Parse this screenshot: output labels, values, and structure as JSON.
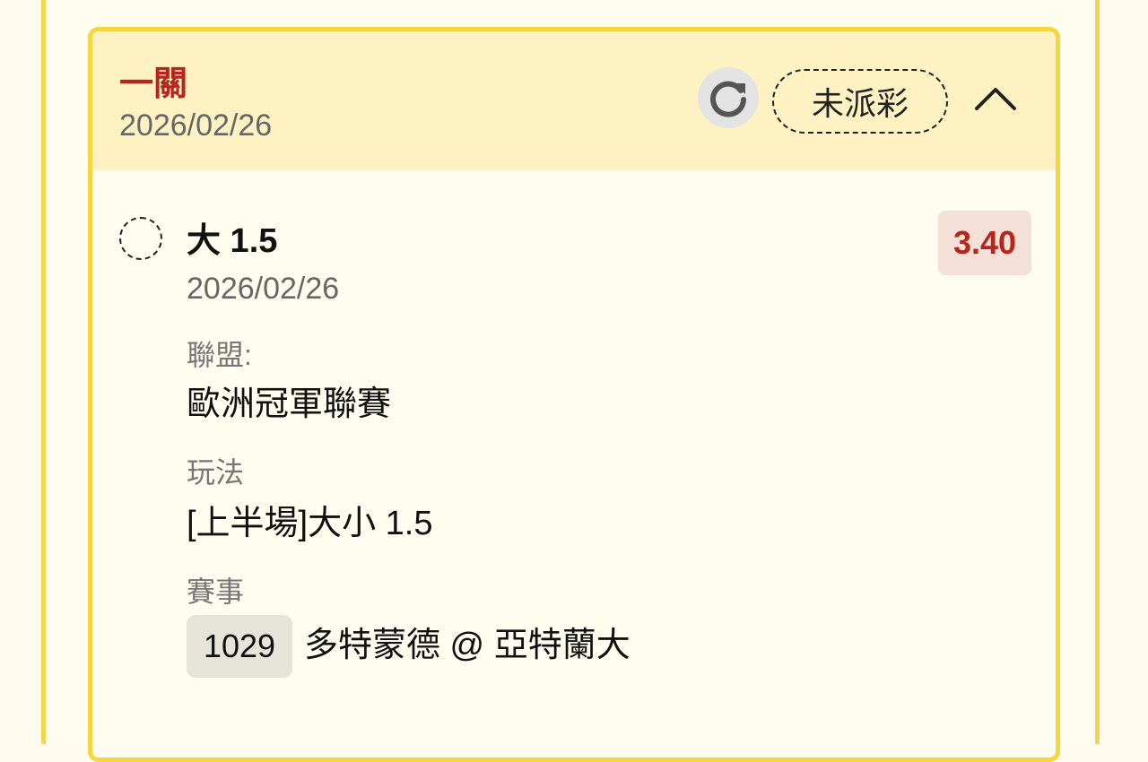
{
  "bet": {
    "title": "一關",
    "date": "2026/02/26",
    "status": "未派彩",
    "accent_color": "#b5261e",
    "highlight_color": "#f6d63c"
  },
  "icons": {
    "refresh": "refresh-icon",
    "collapse": "chevron-up-icon",
    "pending": "dashed-circle-icon"
  },
  "selection": {
    "name": "大 1.5",
    "date": "2026/02/26",
    "odds": "3.40",
    "league_label": "聯盟:",
    "league_value": "歐洲冠軍聯賽",
    "market_label": "玩法",
    "market_value": "[上半場]大小 1.5",
    "event_label": "賽事",
    "match_code": "1029",
    "match_teams": "多特蒙德 @ 亞特蘭大"
  }
}
